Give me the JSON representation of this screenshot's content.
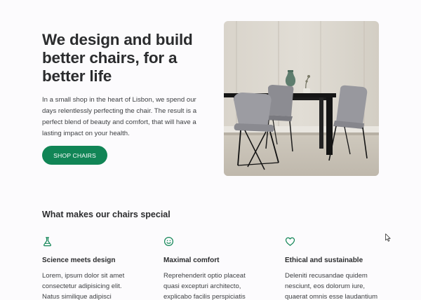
{
  "hero": {
    "title": "We design and build better chairs, for a better life",
    "text": "In a small shop in the heart of Lisbon, we spend our days relentlessly perfecting the chair. The result is a perfect blend of beauty and comfort, that will have a lasting impact on your health.",
    "cta_label": "SHOP CHAIRS",
    "accent_color": "#118556"
  },
  "features": {
    "title": "What makes our chairs special",
    "items": [
      {
        "icon": "flask-icon",
        "title": "Science meets design",
        "text": "Lorem, ipsum dolor sit amet consectetur adipisicing elit. Natus similique adipisci"
      },
      {
        "icon": "smiley-icon",
        "title": "Maximal comfort",
        "text": "Reprehenderit optio placeat quasi excepturi architecto, explicabo facilis perspiciatis"
      },
      {
        "icon": "heart-icon",
        "title": "Ethical and sustainable",
        "text": "Deleniti recusandae quidem nesciunt, eos dolorum iure, quaerat omnis esse laudantium"
      }
    ]
  }
}
